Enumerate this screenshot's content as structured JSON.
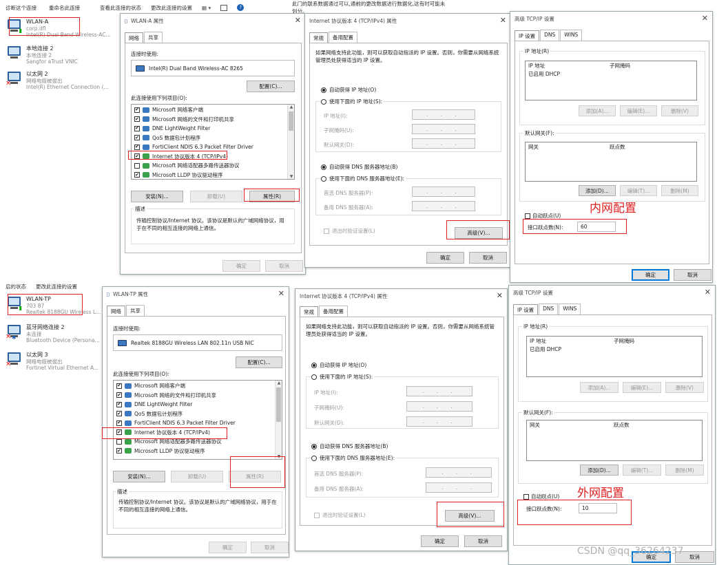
{
  "explorer_top": {
    "toolbar": [
      "诊断这个连接",
      "重命名此连接",
      "查看此连接的状态",
      "更改此连接的设置"
    ],
    "connections": [
      {
        "name": "WLAN-A",
        "line2": "corp.dfl",
        "line3": "Intel(R) Dual Band Wireless-AC...",
        "type": "wifi"
      },
      {
        "name": "本地连接 2",
        "line2": "本地连接 2",
        "line3": "Sangfor aTrust VNIC",
        "type": "lan"
      },
      {
        "name": "以太网 2",
        "line2": "网络电缆被拔出",
        "line3": "Intel(R) Ethernet Connection (...",
        "type": "lan-x"
      }
    ]
  },
  "explorer_bottom": {
    "toolbar": [
      "启的状态",
      "更改此连接的设置"
    ],
    "connections": [
      {
        "name": "WLAN-TP",
        "line2": "703 87",
        "line3": "Realtek 8188GU Wireless L...",
        "type": "wifi"
      },
      {
        "name": "蓝牙网络连接 2",
        "line2": "未连接",
        "line3": "Bluetooth Device (Persona...",
        "type": "bt-x"
      },
      {
        "name": "以太网 3",
        "line2": "网络电缆被拔出",
        "line3": "Fortinet Virtual Ethernet A...",
        "type": "lan-x"
      }
    ]
  },
  "top_text": {
    "line1": "此门的联系数据通过可以,通前的更改数据进行数据化,这有时可能未",
    "line2": "划分。"
  },
  "props_a": {
    "title": "WLAN-A 属性",
    "tabs": [
      "网络",
      "共享"
    ],
    "connect_using_label": "连接时使用:",
    "adapter": "Intel(R) Dual Band Wireless-AC 8265",
    "configure": "配置(C)...",
    "items_label": "此连接使用下列项目(O):",
    "items": [
      {
        "label": "Microsoft 网络客户端",
        "checked": true,
        "icon": "blue"
      },
      {
        "label": "Microsoft 网络的文件和打印机共享",
        "checked": true,
        "icon": "blue"
      },
      {
        "label": "DNE LightWeight Filter",
        "checked": true,
        "icon": "blue"
      },
      {
        "label": "QoS 数据包计划程序",
        "checked": true,
        "icon": "blue"
      },
      {
        "label": "FortiClient NDIS 6.3 Packet Filter Driver",
        "checked": true,
        "icon": "blue"
      },
      {
        "label": "Internet 协议版本 4 (TCP/IPv4)",
        "checked": true,
        "icon": "green"
      },
      {
        "label": "Microsoft 网络适配器多路传送器协议",
        "checked": false,
        "icon": "green"
      },
      {
        "label": "Microsoft LLDP 协议驱动程序",
        "checked": true,
        "icon": "green"
      }
    ],
    "install": "安装(N)...",
    "uninstall": "卸载(U)",
    "properties": "属性(R)",
    "desc_label": "描述",
    "desc": "传输控制协议/Internet 协议。该协议是默认的广域网络协议，用于在不同的相互连接的网络上通信。",
    "ok": "确定",
    "cancel": "取消"
  },
  "props_b": {
    "title": "WLAN-TP 属性",
    "tabs": [
      "网络",
      "共享"
    ],
    "connect_using_label": "连接时使用:",
    "adapter": "Realtek 8188GU Wireless LAN 802.11n USB NIC",
    "configure": "配置(C)...",
    "items_label": "此连接使用下列项目(O):",
    "items": [
      {
        "label": "Microsoft 网络客户端",
        "checked": true,
        "icon": "blue"
      },
      {
        "label": "Microsoft 网络的文件和打印机共享",
        "checked": true,
        "icon": "blue"
      },
      {
        "label": "DNE LightWeight Filter",
        "checked": true,
        "icon": "blue"
      },
      {
        "label": "QoS 数据包计划程序",
        "checked": true,
        "icon": "blue"
      },
      {
        "label": "FortiClient NDIS 6.3 Packet Filter Driver",
        "checked": true,
        "icon": "blue"
      },
      {
        "label": "Internet 协议版本 4 (TCP/IPv4)",
        "checked": true,
        "icon": "green"
      },
      {
        "label": "Microsoft 网络适配器多路传送器协议",
        "checked": false,
        "icon": "green"
      },
      {
        "label": "Microsoft LLDP 协议驱动程序",
        "checked": true,
        "icon": "green"
      }
    ],
    "install": "安装(N)...",
    "uninstall": "卸载(U)",
    "properties": "属性(R)",
    "desc_label": "描述",
    "desc": "传输控制协议/Internet 协议。该协议是默认的广域网络协议，用于在不同的相互连接的网络上通信。",
    "ok": "确定",
    "cancel": "取消"
  },
  "ipv4_a": {
    "title": "Internet 协议版本 4 (TCP/IPv4) 属性",
    "tabs": [
      "常规",
      "备用配置"
    ],
    "intro": "如果网络支持此功能，则可以获取自动指派的 IP 设置。否则，你需要从网络系统管理员处获得适当的 IP 设置。",
    "auto_ip": "自动获得 IP 地址(O)",
    "manual_ip": "使用下面的 IP 地址(S):",
    "ip_label": "IP 地址(I):",
    "mask_label": "子网掩码(U):",
    "gw_label": "默认网关(D):",
    "auto_dns": "自动获得 DNS 服务器地址(B)",
    "manual_dns": "使用下面的 DNS 服务器地址(E):",
    "dns1": "首选 DNS 服务器(P):",
    "dns2": "备用 DNS 服务器(A):",
    "validate": "退出时验证设置(L)",
    "advanced": "高级(V)...",
    "ok": "确定",
    "cancel": "取消",
    "dots": "..."
  },
  "ipv4_b": {
    "title": "Internet 协议版本 4 (TCP/IPv4) 属性",
    "tabs": [
      "常规",
      "备用配置"
    ],
    "intro": "如果网络支持此功能，则可以获取自动指派的 IP 设置。否则，你需要从网络系统管理员处获得适当的 IP 设置。",
    "auto_ip": "自动获得 IP 地址(O)",
    "manual_ip": "使用下面的 IP 地址(S):",
    "ip_label": "IP 地址(I):",
    "mask_label": "子网掩码(U):",
    "gw_label": "默认网关(D):",
    "auto_dns": "自动获得 DNS 服务器地址(B)",
    "manual_dns": "使用下面的 DNS 服务器地址(E):",
    "dns1": "首选 DNS 服务器(P):",
    "dns2": "备用 DNS 服务器(A):",
    "validate": "退出时验证设置(L)",
    "advanced": "高级(V)...",
    "ok": "确定",
    "cancel": "取消",
    "dots": "..."
  },
  "adv_a": {
    "title": "高级 TCP/IP 设置",
    "tabs": [
      "IP 设置",
      "DNS",
      "WINS"
    ],
    "ip_group": "IP 地址(R)",
    "col_ip": "IP 地址",
    "col_mask": "子网掩码",
    "dhcp": "已启用 DHCP",
    "add": "添加(A)...",
    "edit": "编辑(E)...",
    "remove": "删除(V)",
    "gw_group": "默认网关(F):",
    "col_gw": "网关",
    "col_metric": "跃点数",
    "add2": "添加(D)...",
    "edit2": "编辑(T)...",
    "remove2": "删除(M)",
    "auto_metric": "自动跃点(U)",
    "iface_metric": "接口跃点数(N):",
    "metric_value": "60",
    "ok": "确定",
    "cancel": "取消"
  },
  "adv_b": {
    "title": "高级 TCP/IP 设置",
    "tabs": [
      "IP 设置",
      "DNS",
      "WINS"
    ],
    "ip_group": "IP 地址(R)",
    "col_ip": "IP 地址",
    "col_mask": "子网掩码",
    "dhcp": "已启用 DHCP",
    "add": "添加(A)...",
    "edit": "编辑(E)...",
    "remove": "删除(V)",
    "gw_group": "默认网关(F):",
    "col_gw": "网关",
    "col_metric": "跃点数",
    "add2": "添加(D)...",
    "edit2": "编辑(T)...",
    "remove2": "删除(M)",
    "auto_metric": "自动跃点(U)",
    "iface_metric": "接口跃点数(N):",
    "metric_value": "10",
    "ok": "确定",
    "cancel": "取消"
  },
  "annotations": {
    "inner": "内网配置",
    "outer": "外网配置"
  },
  "watermark": "CSDN @qq_36264237",
  "colors": {
    "annotation": "#e02020",
    "accent": "#0078d7"
  }
}
